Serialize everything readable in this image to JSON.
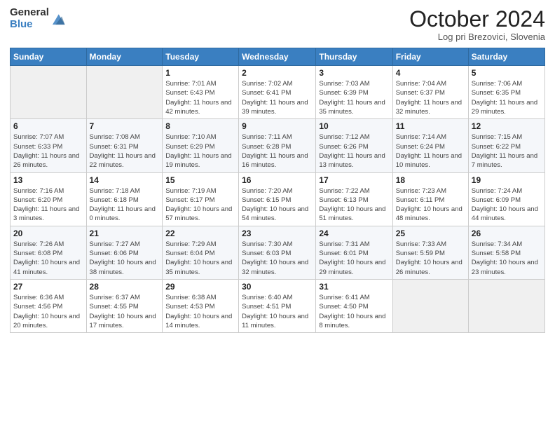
{
  "logo": {
    "general": "General",
    "blue": "Blue"
  },
  "title": "October 2024",
  "location": "Log pri Brezovici, Slovenia",
  "days_of_week": [
    "Sunday",
    "Monday",
    "Tuesday",
    "Wednesday",
    "Thursday",
    "Friday",
    "Saturday"
  ],
  "weeks": [
    [
      {
        "day": "",
        "sunrise": "",
        "sunset": "",
        "daylight": ""
      },
      {
        "day": "",
        "sunrise": "",
        "sunset": "",
        "daylight": ""
      },
      {
        "day": "1",
        "sunrise": "Sunrise: 7:01 AM",
        "sunset": "Sunset: 6:43 PM",
        "daylight": "Daylight: 11 hours and 42 minutes."
      },
      {
        "day": "2",
        "sunrise": "Sunrise: 7:02 AM",
        "sunset": "Sunset: 6:41 PM",
        "daylight": "Daylight: 11 hours and 39 minutes."
      },
      {
        "day": "3",
        "sunrise": "Sunrise: 7:03 AM",
        "sunset": "Sunset: 6:39 PM",
        "daylight": "Daylight: 11 hours and 35 minutes."
      },
      {
        "day": "4",
        "sunrise": "Sunrise: 7:04 AM",
        "sunset": "Sunset: 6:37 PM",
        "daylight": "Daylight: 11 hours and 32 minutes."
      },
      {
        "day": "5",
        "sunrise": "Sunrise: 7:06 AM",
        "sunset": "Sunset: 6:35 PM",
        "daylight": "Daylight: 11 hours and 29 minutes."
      }
    ],
    [
      {
        "day": "6",
        "sunrise": "Sunrise: 7:07 AM",
        "sunset": "Sunset: 6:33 PM",
        "daylight": "Daylight: 11 hours and 26 minutes."
      },
      {
        "day": "7",
        "sunrise": "Sunrise: 7:08 AM",
        "sunset": "Sunset: 6:31 PM",
        "daylight": "Daylight: 11 hours and 22 minutes."
      },
      {
        "day": "8",
        "sunrise": "Sunrise: 7:10 AM",
        "sunset": "Sunset: 6:29 PM",
        "daylight": "Daylight: 11 hours and 19 minutes."
      },
      {
        "day": "9",
        "sunrise": "Sunrise: 7:11 AM",
        "sunset": "Sunset: 6:28 PM",
        "daylight": "Daylight: 11 hours and 16 minutes."
      },
      {
        "day": "10",
        "sunrise": "Sunrise: 7:12 AM",
        "sunset": "Sunset: 6:26 PM",
        "daylight": "Daylight: 11 hours and 13 minutes."
      },
      {
        "day": "11",
        "sunrise": "Sunrise: 7:14 AM",
        "sunset": "Sunset: 6:24 PM",
        "daylight": "Daylight: 11 hours and 10 minutes."
      },
      {
        "day": "12",
        "sunrise": "Sunrise: 7:15 AM",
        "sunset": "Sunset: 6:22 PM",
        "daylight": "Daylight: 11 hours and 7 minutes."
      }
    ],
    [
      {
        "day": "13",
        "sunrise": "Sunrise: 7:16 AM",
        "sunset": "Sunset: 6:20 PM",
        "daylight": "Daylight: 11 hours and 3 minutes."
      },
      {
        "day": "14",
        "sunrise": "Sunrise: 7:18 AM",
        "sunset": "Sunset: 6:18 PM",
        "daylight": "Daylight: 11 hours and 0 minutes."
      },
      {
        "day": "15",
        "sunrise": "Sunrise: 7:19 AM",
        "sunset": "Sunset: 6:17 PM",
        "daylight": "Daylight: 10 hours and 57 minutes."
      },
      {
        "day": "16",
        "sunrise": "Sunrise: 7:20 AM",
        "sunset": "Sunset: 6:15 PM",
        "daylight": "Daylight: 10 hours and 54 minutes."
      },
      {
        "day": "17",
        "sunrise": "Sunrise: 7:22 AM",
        "sunset": "Sunset: 6:13 PM",
        "daylight": "Daylight: 10 hours and 51 minutes."
      },
      {
        "day": "18",
        "sunrise": "Sunrise: 7:23 AM",
        "sunset": "Sunset: 6:11 PM",
        "daylight": "Daylight: 10 hours and 48 minutes."
      },
      {
        "day": "19",
        "sunrise": "Sunrise: 7:24 AM",
        "sunset": "Sunset: 6:09 PM",
        "daylight": "Daylight: 10 hours and 44 minutes."
      }
    ],
    [
      {
        "day": "20",
        "sunrise": "Sunrise: 7:26 AM",
        "sunset": "Sunset: 6:08 PM",
        "daylight": "Daylight: 10 hours and 41 minutes."
      },
      {
        "day": "21",
        "sunrise": "Sunrise: 7:27 AM",
        "sunset": "Sunset: 6:06 PM",
        "daylight": "Daylight: 10 hours and 38 minutes."
      },
      {
        "day": "22",
        "sunrise": "Sunrise: 7:29 AM",
        "sunset": "Sunset: 6:04 PM",
        "daylight": "Daylight: 10 hours and 35 minutes."
      },
      {
        "day": "23",
        "sunrise": "Sunrise: 7:30 AM",
        "sunset": "Sunset: 6:03 PM",
        "daylight": "Daylight: 10 hours and 32 minutes."
      },
      {
        "day": "24",
        "sunrise": "Sunrise: 7:31 AM",
        "sunset": "Sunset: 6:01 PM",
        "daylight": "Daylight: 10 hours and 29 minutes."
      },
      {
        "day": "25",
        "sunrise": "Sunrise: 7:33 AM",
        "sunset": "Sunset: 5:59 PM",
        "daylight": "Daylight: 10 hours and 26 minutes."
      },
      {
        "day": "26",
        "sunrise": "Sunrise: 7:34 AM",
        "sunset": "Sunset: 5:58 PM",
        "daylight": "Daylight: 10 hours and 23 minutes."
      }
    ],
    [
      {
        "day": "27",
        "sunrise": "Sunrise: 6:36 AM",
        "sunset": "Sunset: 4:56 PM",
        "daylight": "Daylight: 10 hours and 20 minutes."
      },
      {
        "day": "28",
        "sunrise": "Sunrise: 6:37 AM",
        "sunset": "Sunset: 4:55 PM",
        "daylight": "Daylight: 10 hours and 17 minutes."
      },
      {
        "day": "29",
        "sunrise": "Sunrise: 6:38 AM",
        "sunset": "Sunset: 4:53 PM",
        "daylight": "Daylight: 10 hours and 14 minutes."
      },
      {
        "day": "30",
        "sunrise": "Sunrise: 6:40 AM",
        "sunset": "Sunset: 4:51 PM",
        "daylight": "Daylight: 10 hours and 11 minutes."
      },
      {
        "day": "31",
        "sunrise": "Sunrise: 6:41 AM",
        "sunset": "Sunset: 4:50 PM",
        "daylight": "Daylight: 10 hours and 8 minutes."
      },
      {
        "day": "",
        "sunrise": "",
        "sunset": "",
        "daylight": ""
      },
      {
        "day": "",
        "sunrise": "",
        "sunset": "",
        "daylight": ""
      }
    ]
  ]
}
